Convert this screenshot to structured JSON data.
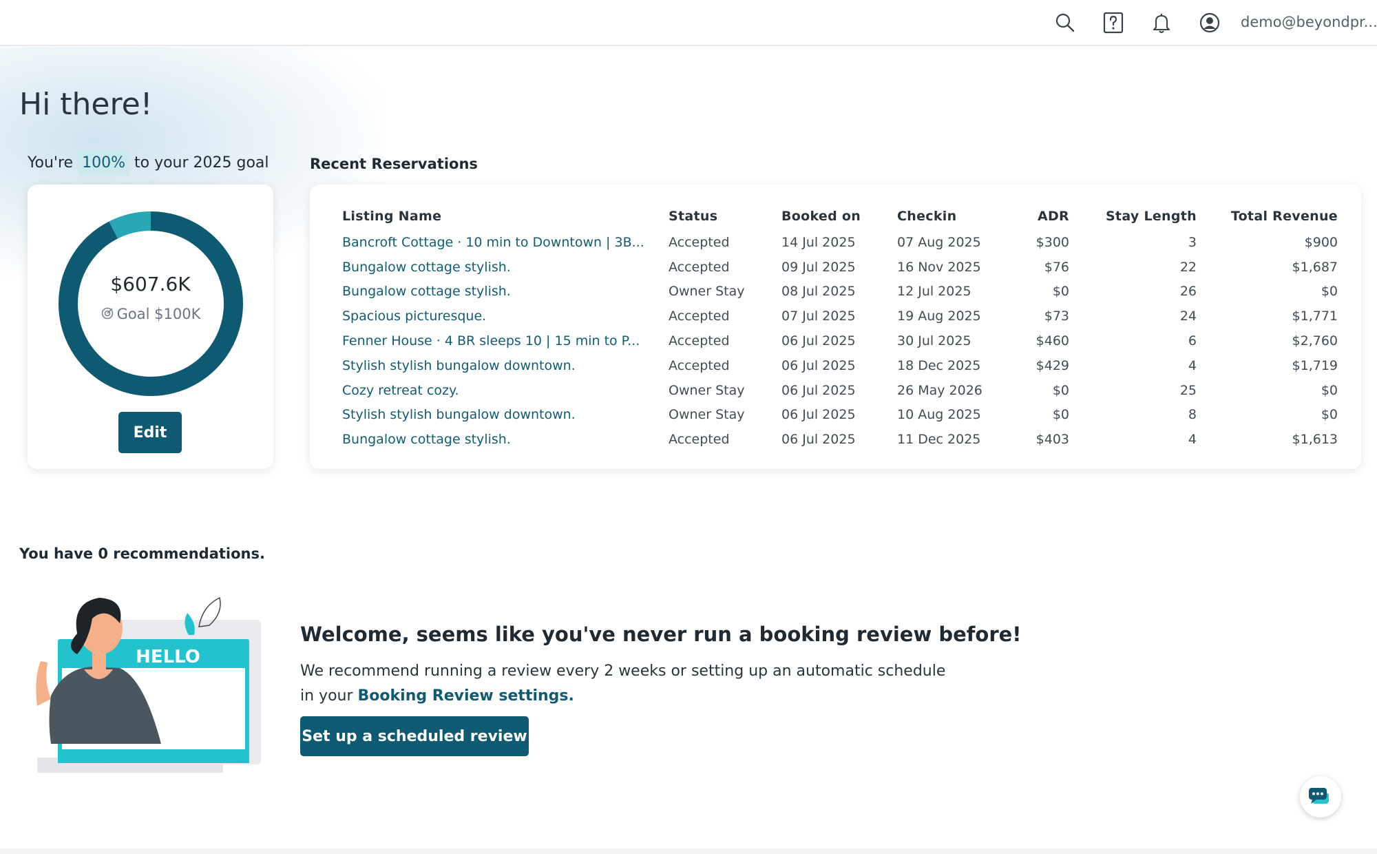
{
  "header": {
    "user_email": "demo@beyondpr...",
    "icons": [
      "search-icon",
      "help-icon",
      "bell-icon",
      "account-icon"
    ]
  },
  "greeting": "Hi there!",
  "goal": {
    "prefix": "You're",
    "percent": "100%",
    "suffix": "to your 2025 goal",
    "value": "$607.6K",
    "goal_label": "Goal $100K",
    "edit_label": "Edit",
    "progress_fraction": 1.0,
    "colors": {
      "main": "#0f5a73",
      "accent": "#2aa7b5"
    }
  },
  "reservations": {
    "title": "Recent Reservations",
    "columns": [
      "Listing Name",
      "Status",
      "Booked on",
      "Checkin",
      "ADR",
      "Stay Length",
      "Total Revenue"
    ],
    "rows": [
      [
        "Bancroft Cottage · 10 min to Downtown | 3B...",
        "Accepted",
        "14 Jul 2025",
        "07 Aug 2025",
        "$300",
        "3",
        "$900"
      ],
      [
        "Bungalow cottage stylish.",
        "Accepted",
        "09 Jul 2025",
        "16 Nov 2025",
        "$76",
        "22",
        "$1,687"
      ],
      [
        "Bungalow cottage stylish.",
        "Owner Stay",
        "08 Jul 2025",
        "12 Jul 2025",
        "$0",
        "26",
        "$0"
      ],
      [
        "Spacious picturesque.",
        "Accepted",
        "07 Jul 2025",
        "19 Aug 2025",
        "$73",
        "24",
        "$1,771"
      ],
      [
        "Fenner House · 4 BR sleeps 10 | 15 min to P...",
        "Accepted",
        "06 Jul 2025",
        "30 Jul 2025",
        "$460",
        "6",
        "$2,760"
      ],
      [
        "Stylish stylish bungalow downtown.",
        "Accepted",
        "06 Jul 2025",
        "18 Dec 2025",
        "$429",
        "4",
        "$1,719"
      ],
      [
        "Cozy retreat cozy.",
        "Owner Stay",
        "06 Jul 2025",
        "26 May 2026",
        "$0",
        "25",
        "$0"
      ],
      [
        "Stylish stylish bungalow downtown.",
        "Owner Stay",
        "06 Jul 2025",
        "10 Aug 2025",
        "$0",
        "8",
        "$0"
      ],
      [
        "Bungalow cottage stylish.",
        "Accepted",
        "06 Jul 2025",
        "11 Dec 2025",
        "$403",
        "4",
        "$1,613"
      ]
    ]
  },
  "recommendations": {
    "count_text": "You have 0 recommendations.",
    "illustration_text": "HELLO",
    "welcome_heading": "Welcome, seems like you've never run a booking review before!",
    "welcome_body": "We recommend running a review every 2 weeks or setting up an automatic schedule in your",
    "settings_link": "Booking Review settings.",
    "button_label": "Set up a scheduled review"
  },
  "chat": {
    "icon": "chat-icon"
  }
}
